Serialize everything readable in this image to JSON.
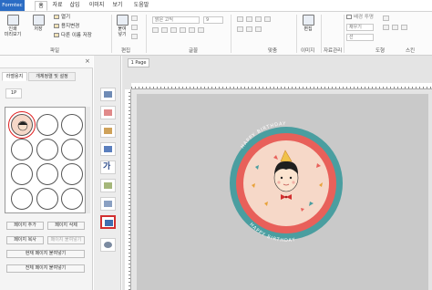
{
  "menubar": {
    "brand": "Formtec",
    "tabs": [
      "홈",
      "자료",
      "삽입",
      "이미지",
      "보기",
      "도움말"
    ]
  },
  "ribbon": {
    "print_preview": "인쇄\n미리보기",
    "save": "저장",
    "open": "열기",
    "paper_change": "용지변경",
    "save_as": "다른 이름 저장",
    "paste": "붙여\n넣기",
    "group_file": "파일",
    "group_edit": "편집",
    "group_font": "글꼴",
    "group_align": "맞춤",
    "group_image": "이미지",
    "group_data": "자료관리",
    "group_shape": "도형",
    "group_style": "스킨",
    "font_name": "맑은 고딕",
    "font_size": "9",
    "edit": "편집",
    "bg_transparent": "배경 투명",
    "rotate": "회전",
    "fill": "채우기",
    "line": "선"
  },
  "left_panel": {
    "tabs": [
      "라벨용지",
      "개체정렬 및 설정"
    ],
    "page_label": "1P",
    "buttons": {
      "add_page": "페이지 추가",
      "delete_page": "페이지 삭제",
      "copy_page": "페이지 복사",
      "paste_page": "페이지 붙여넣기",
      "paste_current": "현재 페이지 붙여넣기",
      "paste_all": "전체 페이지 붙여넣기"
    }
  },
  "canvas": {
    "page_tab": "1 Page",
    "sticker_text_top": "HAPPY BIRTHDAY",
    "sticker_text_bottom": "HAPPY BIRTHDAY"
  },
  "colors": {
    "brand_blue": "#2b6cc4",
    "selection_red": "#d23030",
    "sticker_teal": "#4a9ea0",
    "sticker_ring": "#e8605a",
    "sticker_fill": "#f6d8c8"
  }
}
